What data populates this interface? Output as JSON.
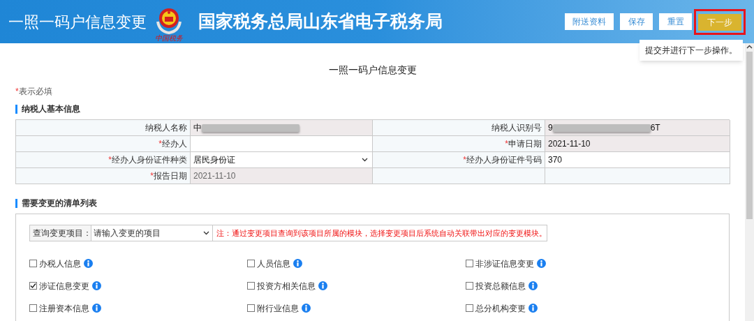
{
  "header": {
    "page_title": "一照一码户信息变更",
    "emblem_caption": "中国税务",
    "site_title": "国家税务总局山东省电子税务局",
    "buttons": [
      {
        "label": "附送资料",
        "kind": "plain",
        "highlighted": false
      },
      {
        "label": "保存",
        "kind": "plain",
        "highlighted": false
      },
      {
        "label": "重置",
        "kind": "plain",
        "highlighted": false
      },
      {
        "label": "下一步",
        "kind": "primary",
        "highlighted": true
      }
    ],
    "tooltip": "提交并进行下一步操作。"
  },
  "form_title": "一照一码户信息变更",
  "required_note": {
    "mark": "*",
    "text": "表示必填"
  },
  "basic_section": {
    "title": "纳税人基本信息",
    "fields": [
      {
        "label": "纳税人名称",
        "required": false,
        "kind": "text",
        "value": "中",
        "redacted": true,
        "readonly": true
      },
      {
        "label": "纳税人识别号",
        "required": false,
        "kind": "text",
        "value": "9",
        "redacted": true,
        "value_end": "6T",
        "readonly": true
      },
      {
        "label": "经办人",
        "required": true,
        "kind": "text",
        "readonly": false
      },
      {
        "label": "申请日期",
        "required": true,
        "kind": "text",
        "value": "2021-11-10",
        "readonly": true
      },
      {
        "label": "经办人身份证件种类",
        "required": true,
        "kind": "select",
        "value": "居民身份证",
        "readonly": false
      },
      {
        "label": "经办人身份证件号码",
        "required": true,
        "kind": "text",
        "value": "370",
        "readonly": false
      },
      {
        "label": "报告日期",
        "required": true,
        "kind": "text",
        "value": "2021-11-10",
        "readonly": true
      }
    ]
  },
  "change_section": {
    "title": "需要变更的清单列表",
    "search_label": "查询变更项目：",
    "search_placeholder": "请输入变更的项目",
    "note": "注：通过变更项目查询到该项目所属的模块，选择变更项目后系统自动关联带出对应的变更模块。",
    "items": [
      {
        "label": "办税人信息",
        "checked": false
      },
      {
        "label": "人员信息",
        "checked": false
      },
      {
        "label": "非涉证信息变更",
        "checked": false
      },
      {
        "label": "涉证信息变更",
        "checked": true
      },
      {
        "label": "投资方相关信息",
        "checked": false
      },
      {
        "label": "投资总额信息",
        "checked": false
      },
      {
        "label": "注册资本信息",
        "checked": false
      },
      {
        "label": "附行业信息",
        "checked": false
      },
      {
        "label": "总分机构变更",
        "checked": false
      }
    ]
  }
}
